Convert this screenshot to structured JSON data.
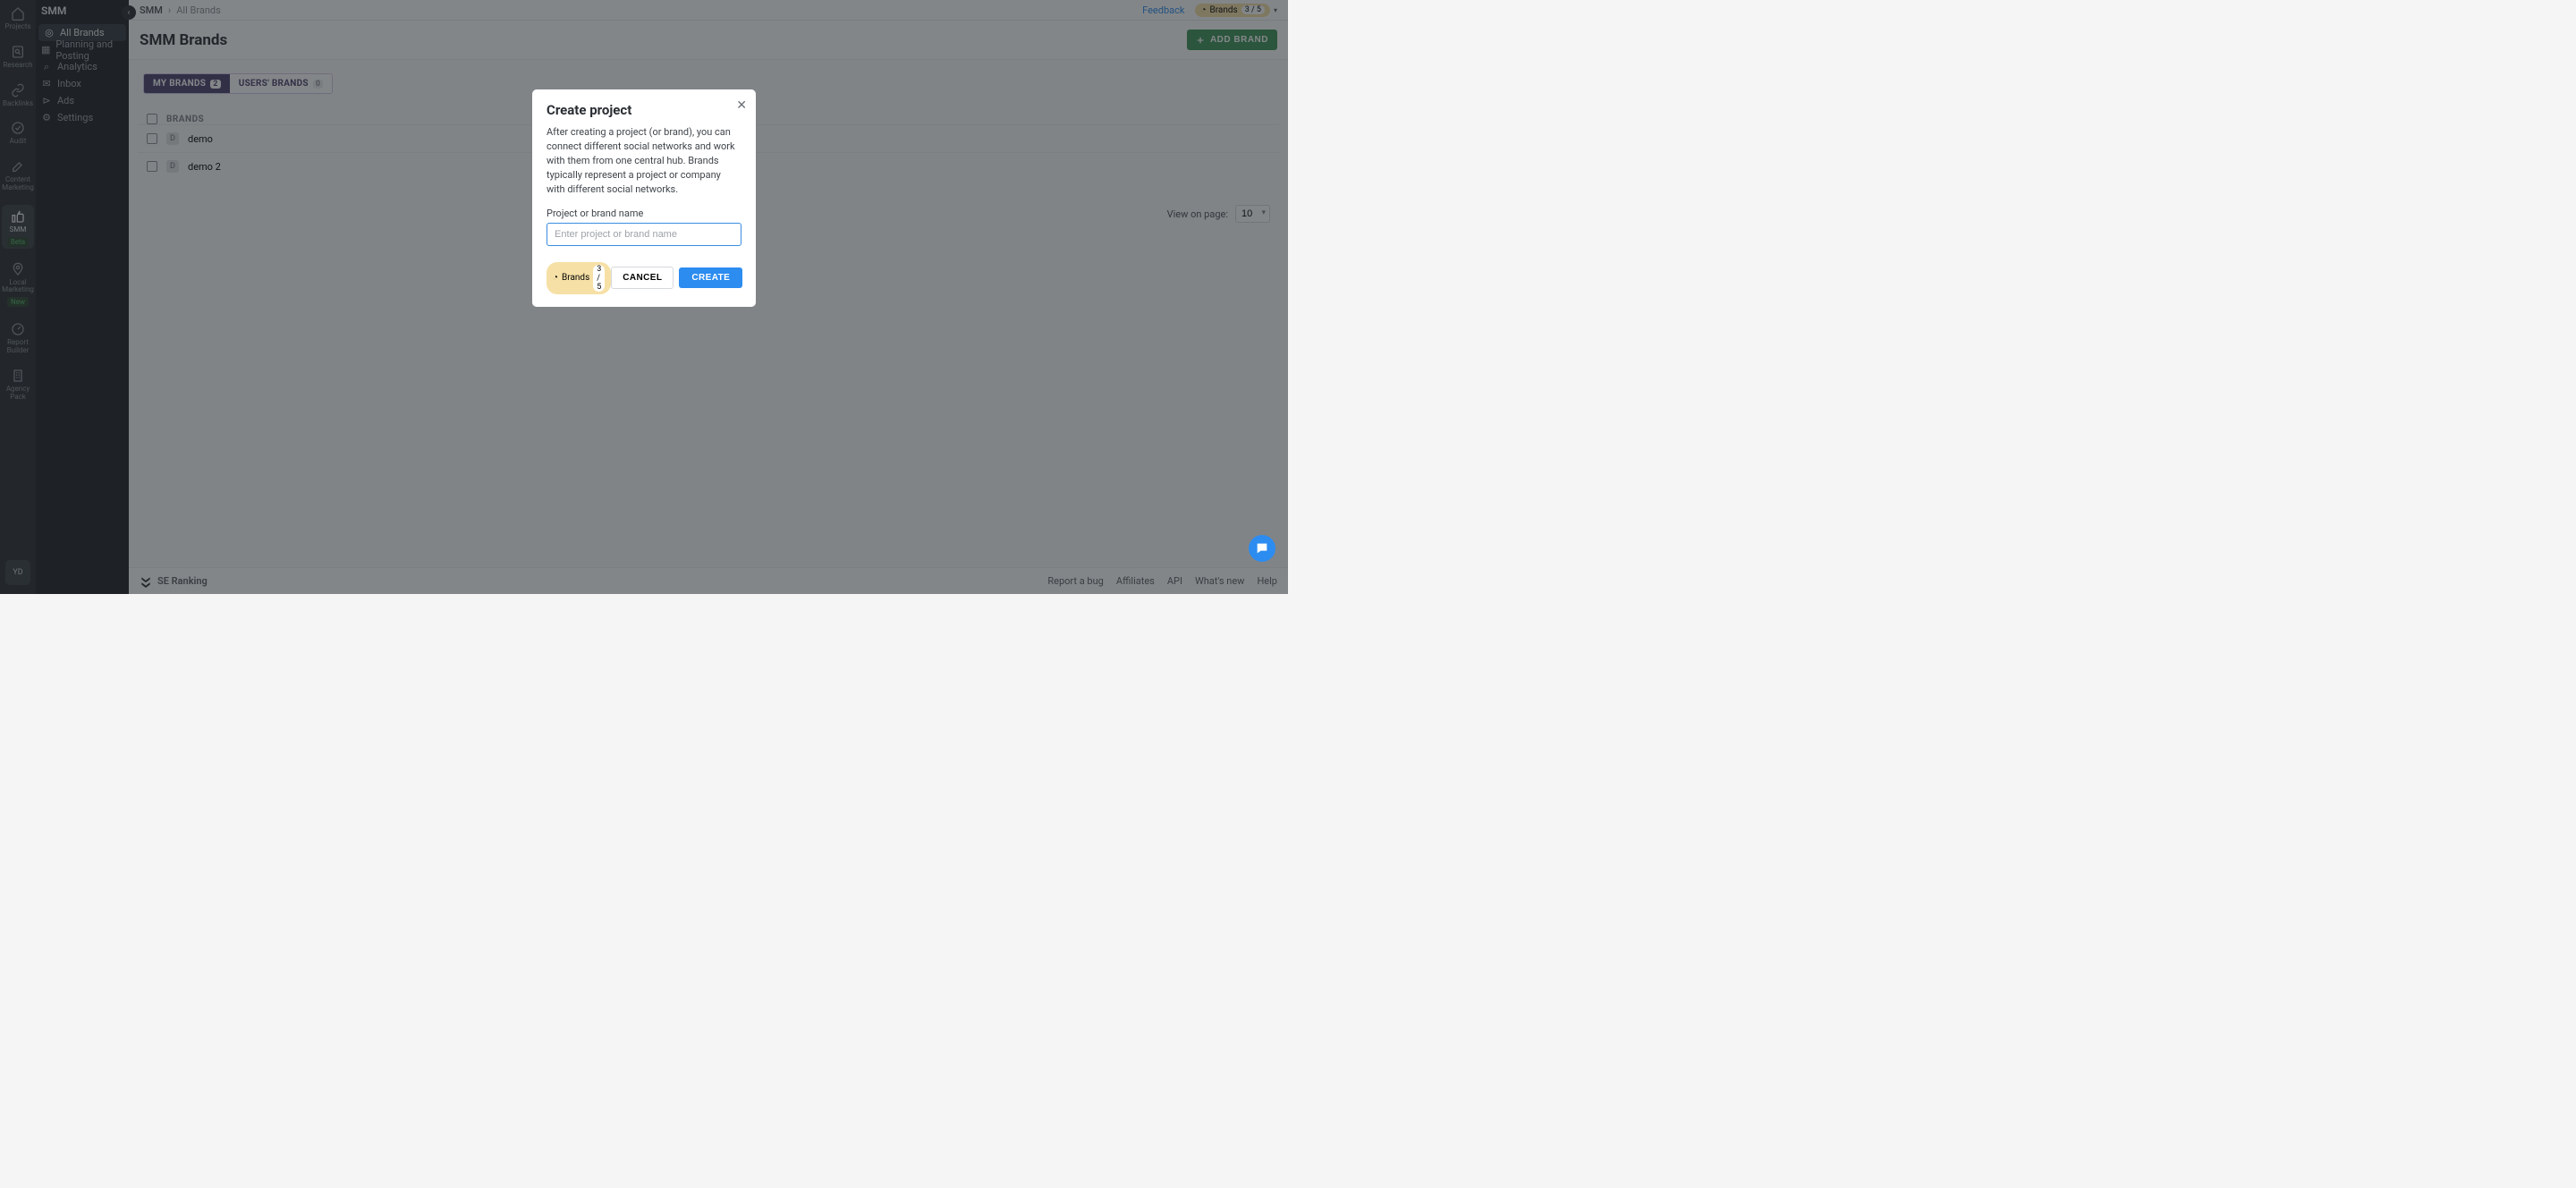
{
  "rail": {
    "items": [
      {
        "label": "Projects",
        "icon": "home"
      },
      {
        "label": "Research",
        "icon": "search-doc"
      },
      {
        "label": "Backlinks",
        "icon": "link"
      },
      {
        "label": "Audit",
        "icon": "check-circle"
      },
      {
        "label": "Content Marketing",
        "icon": "edit"
      },
      {
        "label": "SMM",
        "icon": "thumb",
        "active": true,
        "badge": "Beta"
      },
      {
        "label": "Local Marketing",
        "icon": "pin",
        "badge": "New"
      },
      {
        "label": "Report Builder",
        "icon": "gauge"
      },
      {
        "label": "Agency Pack",
        "icon": "building"
      }
    ],
    "profile": "YD"
  },
  "sidebar": {
    "title": "SMM",
    "items": [
      {
        "label": "All Brands",
        "active": true
      },
      {
        "label": "Planning and Posting"
      },
      {
        "label": "Analytics"
      },
      {
        "label": "Inbox"
      },
      {
        "label": "Ads"
      },
      {
        "label": "Settings"
      }
    ]
  },
  "topbar": {
    "breadcrumb": [
      "SMM",
      "All Brands"
    ],
    "feedback": "Feedback",
    "brands_chip_label": "Brands",
    "brands_chip_count": "3 / 5"
  },
  "page": {
    "title": "SMM Brands",
    "add_brand": "ADD BRAND"
  },
  "tabs": {
    "my_label": "MY BRANDS",
    "my_count": "2",
    "users_label": "USERS' BRANDS",
    "users_count": "0"
  },
  "table": {
    "header": "BRANDS",
    "rows": [
      {
        "initial": "D",
        "name": "demo"
      },
      {
        "initial": "D",
        "name": "demo 2"
      }
    ]
  },
  "pager": {
    "label": "View on page:",
    "value": "10"
  },
  "footer": {
    "logo": "SE Ranking",
    "links": [
      "Report a bug",
      "Affiliates",
      "API",
      "What's new",
      "Help"
    ]
  },
  "modal": {
    "title": "Create project",
    "description": "After creating a project (or brand), you can connect different social networks and work with them from one central hub. Brands typically represent a project or company with different social networks.",
    "input_label": "Project or brand name",
    "input_placeholder": "Enter project or brand name",
    "chip_label": "Brands",
    "chip_count": "3 / 5",
    "cancel": "CANCEL",
    "create": "CREATE"
  }
}
